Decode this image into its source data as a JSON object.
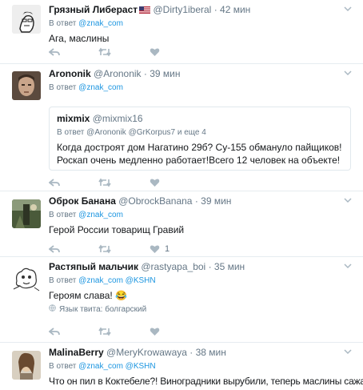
{
  "tweets": [
    {
      "name": "Грязный Либераст",
      "handle": "@Dirty1iberal",
      "time": "42 мин",
      "reply_prefix": "В ответ",
      "reply_to": "@znak_com",
      "text": "Ага, маслины"
    },
    {
      "name": "Arononik",
      "handle": "@Arononik",
      "time": "39 мин",
      "reply_prefix": "В ответ",
      "reply_to": "@znak_com",
      "quote": {
        "name": "mixmix",
        "handle": "@mixmix16",
        "reply_prefix": "В ответ",
        "reply_to": "@Arononik @GrKorpus7 и еще 4",
        "text": "Когда достроят дом Нагатино 29б? Су-155 обмануло пайщиков!Роскап очень медленно работает!Всего 12 человек на объекте!"
      }
    },
    {
      "name": "Оброк Банана",
      "handle": "@ObrockBanana",
      "time": "39 мин",
      "reply_prefix": "В ответ",
      "reply_to": "@znak_com",
      "text": "Герой России товарищ Гравий",
      "like_count": "1"
    },
    {
      "name": "Растяпый мальчик",
      "handle": "@rastyapa_boi",
      "time": "35 мин",
      "reply_prefix": "В ответ",
      "reply_to": "@znak_com @KSHN",
      "text": "Героям слава! 😂",
      "language_note": "Язык твита: болгарский"
    },
    {
      "name": "MalinaBerry",
      "handle": "@MeryKrowawaya",
      "time": "38 мин",
      "reply_prefix": "В ответ",
      "reply_to": "@znak_com @KSHN",
      "text": "Что он пил в Коктебеле?! Виноградники вырубили, теперь маслины сажают"
    }
  ],
  "dot": "·",
  "colors": {
    "link": "#1b95e0",
    "muted": "#657786",
    "border": "#e6ecf0"
  }
}
